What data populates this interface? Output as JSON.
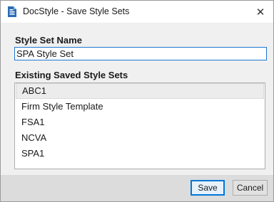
{
  "window": {
    "title": "DocStyle - Save Style Sets",
    "app_icon": "docstyle-app-icon",
    "close_icon": "close-icon",
    "close_glyph": "✕"
  },
  "form": {
    "name_label": "Style Set Name",
    "name_value": "SPA Style Set",
    "list_label": "Existing Saved Style Sets",
    "items": [
      "ABC1",
      "Firm Style Template",
      "FSA1",
      "NCVA",
      "SPA1"
    ]
  },
  "footer": {
    "save_label": "Save",
    "cancel_label": "Cancel"
  },
  "colors": {
    "accent": "#1e78d2",
    "footer_bg": "#dcdcdc",
    "icon_blue": "#2b6cb5"
  }
}
